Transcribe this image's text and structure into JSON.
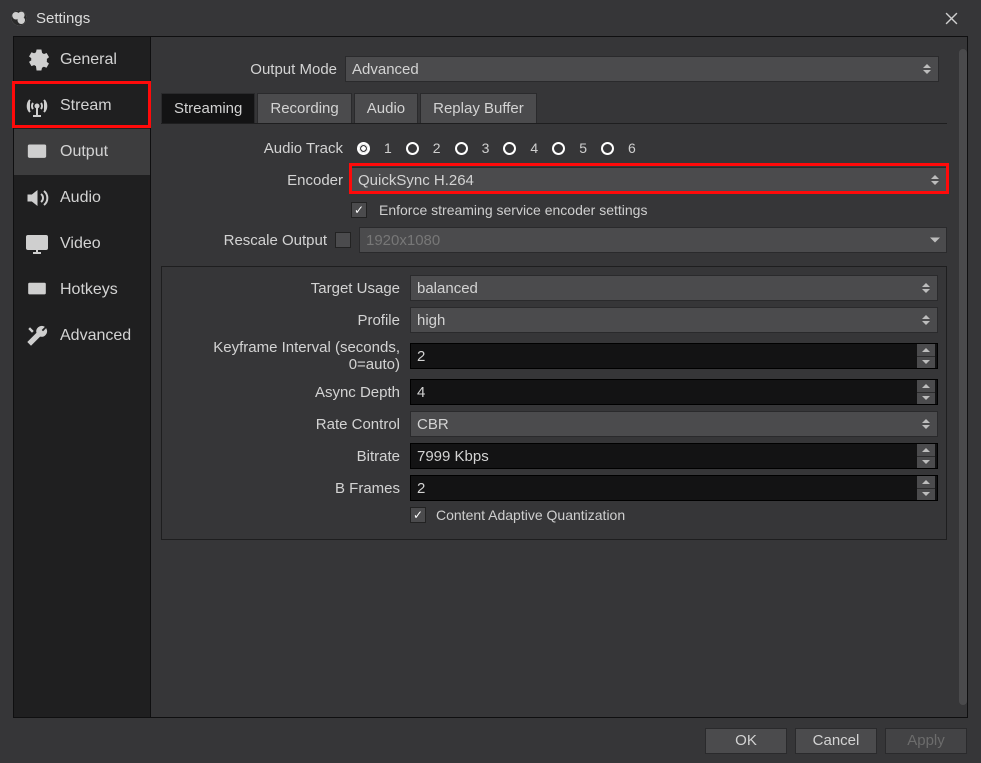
{
  "window": {
    "title": "Settings"
  },
  "sidebar": {
    "items": [
      {
        "label": "General"
      },
      {
        "label": "Stream"
      },
      {
        "label": "Output"
      },
      {
        "label": "Audio"
      },
      {
        "label": "Video"
      },
      {
        "label": "Hotkeys"
      },
      {
        "label": "Advanced"
      }
    ]
  },
  "output_mode": {
    "label": "Output Mode",
    "value": "Advanced"
  },
  "tabs": {
    "streaming": "Streaming",
    "recording": "Recording",
    "audio": "Audio",
    "replay": "Replay Buffer"
  },
  "streaming": {
    "audio_track_label": "Audio Track",
    "audio_tracks": [
      "1",
      "2",
      "3",
      "4",
      "5",
      "6"
    ],
    "encoder_label": "Encoder",
    "encoder_value": "QuickSync H.264",
    "enforce_label": "Enforce streaming service encoder settings",
    "rescale_label": "Rescale Output",
    "rescale_value": "1920x1080",
    "fields": {
      "target_usage": {
        "label": "Target Usage",
        "value": "balanced"
      },
      "profile": {
        "label": "Profile",
        "value": "high"
      },
      "keyframe": {
        "label": "Keyframe Interval (seconds, 0=auto)",
        "value": "2"
      },
      "async_depth": {
        "label": "Async Depth",
        "value": "4"
      },
      "rate_control": {
        "label": "Rate Control",
        "value": "CBR"
      },
      "bitrate": {
        "label": "Bitrate",
        "value": "7999 Kbps"
      },
      "bframes": {
        "label": "B Frames",
        "value": "2"
      },
      "caq_label": "Content Adaptive Quantization"
    }
  },
  "buttons": {
    "ok": "OK",
    "cancel": "Cancel",
    "apply": "Apply"
  }
}
